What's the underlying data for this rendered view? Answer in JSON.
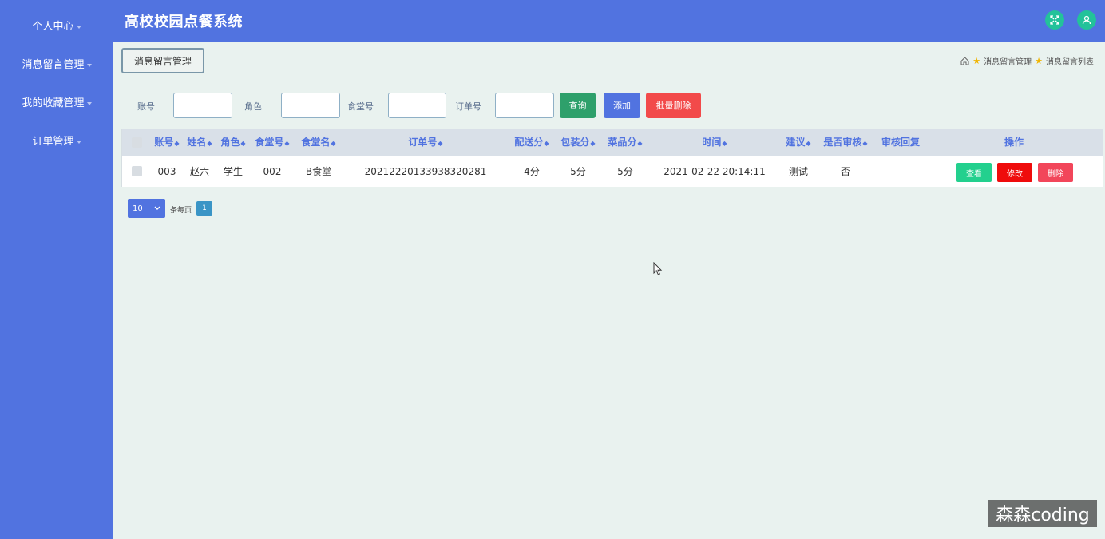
{
  "app": {
    "title": "高校校园点餐系统"
  },
  "sidebar": {
    "items": [
      {
        "label": "个人中心"
      },
      {
        "label": "消息留言管理"
      },
      {
        "label": "我的收藏管理"
      },
      {
        "label": "订单管理"
      }
    ]
  },
  "header": {
    "icons": [
      "fullscreen-icon",
      "user-icon"
    ]
  },
  "page": {
    "tab_label": "消息留言管理",
    "breadcrumb": {
      "item1": "消息留言管理",
      "item2": "消息留言列表"
    }
  },
  "filters": {
    "account_label": "账号",
    "role_label": "角色",
    "canteen_label": "食堂号",
    "order_label": "订单号",
    "account_value": "",
    "role_value": "",
    "canteen_value": "",
    "order_value": ""
  },
  "actions": {
    "query": "查询",
    "add": "添加",
    "batch_delete": "批量删除"
  },
  "table": {
    "headers": {
      "account": "账号",
      "name": "姓名",
      "role": "角色",
      "canteen_no": "食堂号",
      "canteen_name": "食堂名",
      "order_no": "订单号",
      "delivery_score": "配送分",
      "package_score": "包装分",
      "dish_score": "菜品分",
      "time": "时间",
      "suggestion": "建议",
      "reviewed": "是否审核",
      "review_reply": "审核回复",
      "operation": "操作"
    },
    "rows": [
      {
        "account": "003",
        "name": "赵六",
        "role": "学生",
        "canteen_no": "002",
        "canteen_name": "B食堂",
        "order_no": "20212220133938320281",
        "delivery_score": "4分",
        "package_score": "5分",
        "dish_score": "5分",
        "time": "2021-02-22 20:14:11",
        "suggestion": "测试",
        "reviewed": "否",
        "review_reply": "",
        "btn_view": "查看",
        "btn_edit": "修改",
        "btn_delete": "删除"
      }
    ]
  },
  "pagination": {
    "page_size": "10",
    "per_page_label": "条每页",
    "current_page": "1"
  },
  "watermark": "森森coding",
  "colors": {
    "primary": "#5173e0",
    "background": "#e9f2ef",
    "success": "#2ea06b",
    "danger": "#f24a4a"
  }
}
